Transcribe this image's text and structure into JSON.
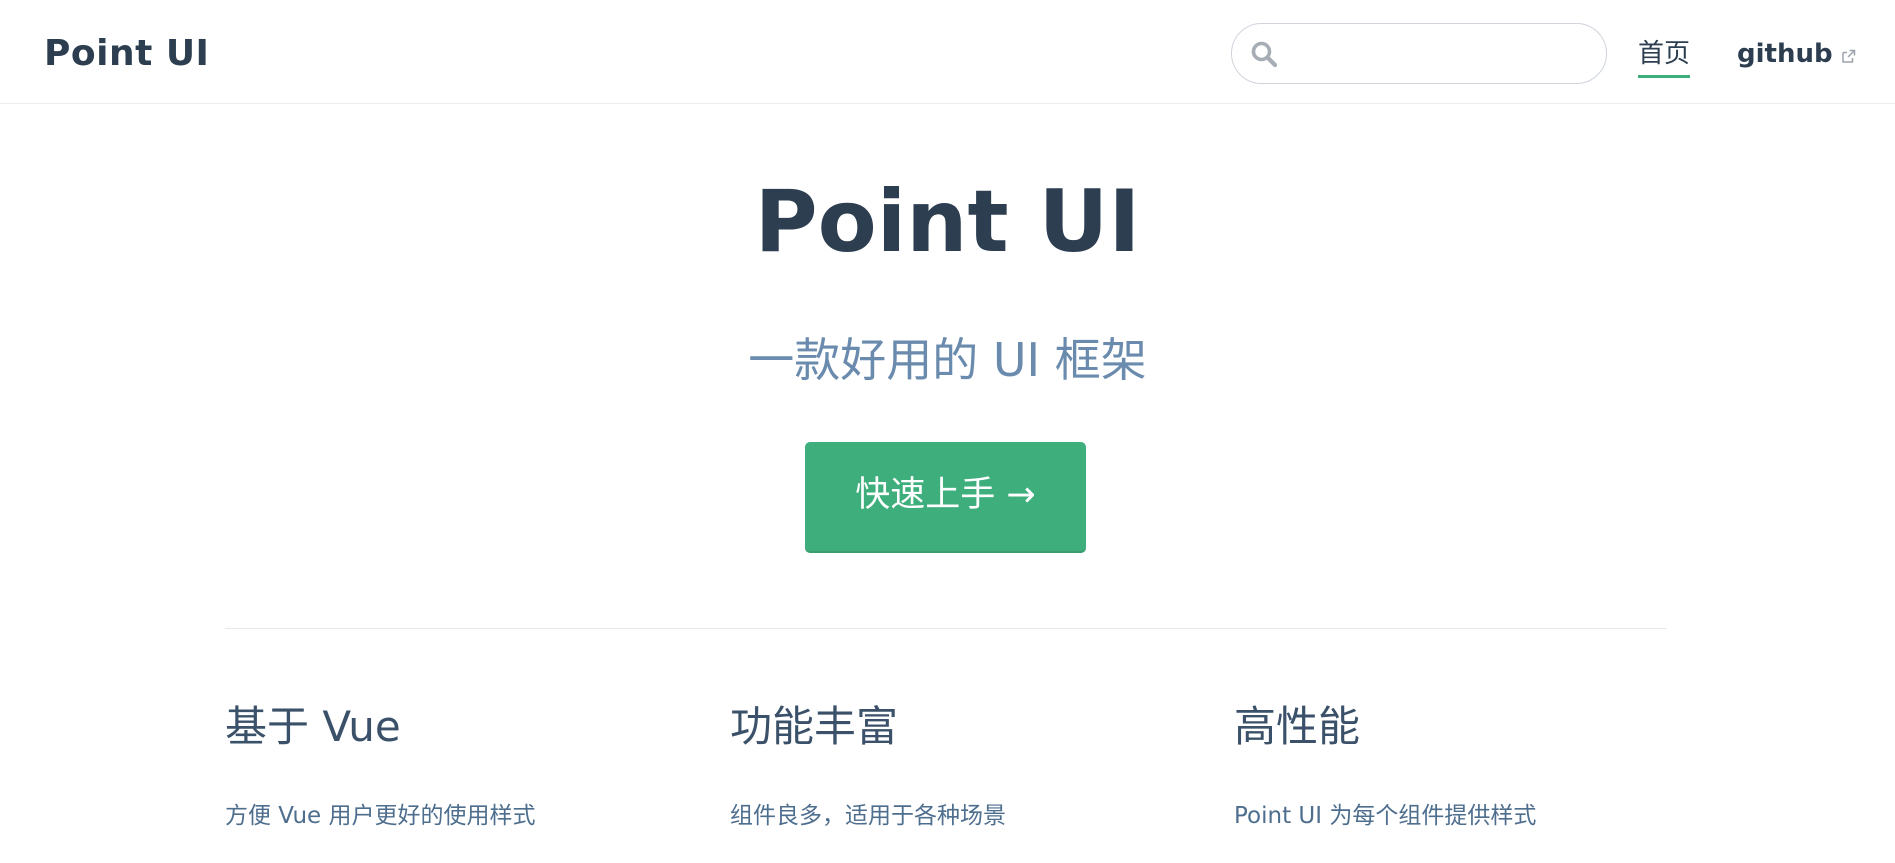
{
  "navbar": {
    "site_name": "Point UI",
    "search_placeholder": "",
    "links": [
      {
        "label": "首页",
        "active": true
      },
      {
        "label": "github",
        "external": true
      }
    ],
    "accent_color": "#3eaf7c"
  },
  "hero": {
    "title": "Point UI",
    "description": "一款好用的 UI 框架",
    "action_label": "快速上手 →"
  },
  "features": [
    {
      "title": "基于 Vue",
      "details": "方便 Vue 用户更好的使用样式"
    },
    {
      "title": "功能丰富",
      "details": "组件良多，适用于各种场景"
    },
    {
      "title": "高性能",
      "details": "Point UI 为每个组件提供样式"
    }
  ],
  "icons": {
    "search": "search-icon",
    "external_link": "external-link-icon"
  }
}
